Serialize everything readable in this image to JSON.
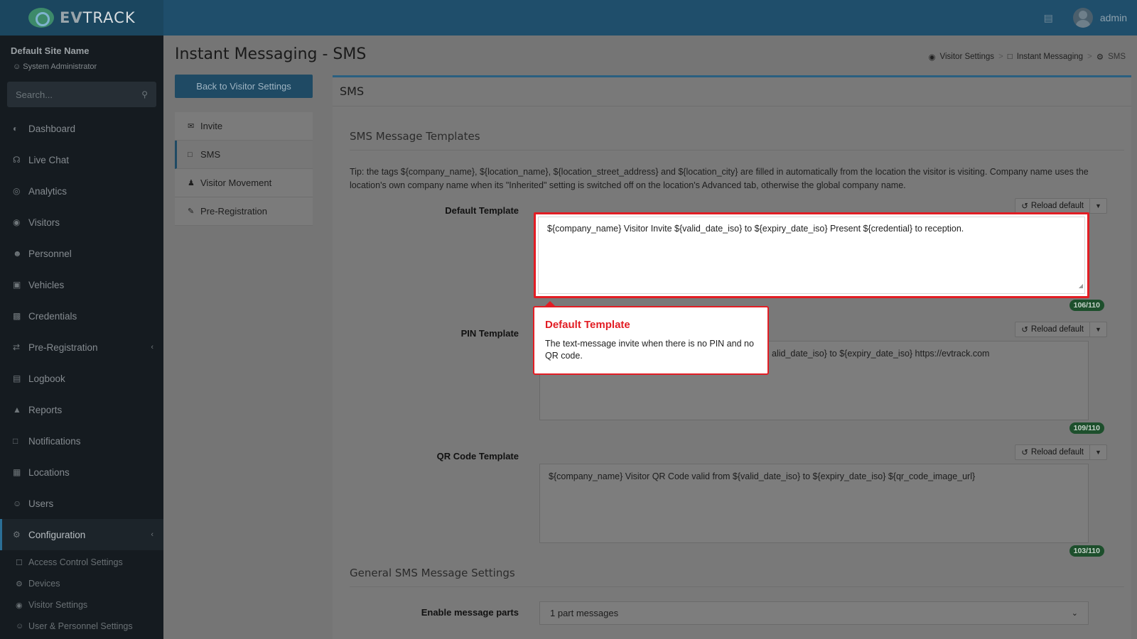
{
  "brand": {
    "logo_prefix": "EV",
    "logo_suffix": "TRACK"
  },
  "topbar": {
    "user_name": "admin"
  },
  "sidebar": {
    "site_name": "Default Site Name",
    "role": "System Administrator",
    "search_placeholder": "Search...",
    "items": [
      {
        "label": "Dashboard",
        "icon": "dashboard-icon"
      },
      {
        "label": "Live Chat",
        "icon": "headset-icon"
      },
      {
        "label": "Analytics",
        "icon": "target-icon"
      },
      {
        "label": "Visitors",
        "icon": "eye-icon"
      },
      {
        "label": "Personnel",
        "icon": "user-gear-icon"
      },
      {
        "label": "Vehicles",
        "icon": "car-icon"
      },
      {
        "label": "Credentials",
        "icon": "id-card-icon"
      },
      {
        "label": "Pre-Registration",
        "icon": "arrows-icon"
      },
      {
        "label": "Logbook",
        "icon": "book-icon"
      },
      {
        "label": "Reports",
        "icon": "chart-icon"
      },
      {
        "label": "Notifications",
        "icon": "message-icon"
      },
      {
        "label": "Locations",
        "icon": "building-icon"
      },
      {
        "label": "Users",
        "icon": "users-icon"
      },
      {
        "label": "Configuration",
        "icon": "gear-icon"
      }
    ],
    "sub_items": [
      {
        "label": "Access Control Settings",
        "icon": "lock-icon"
      },
      {
        "label": "Devices",
        "icon": "chip-icon"
      },
      {
        "label": "Visitor Settings",
        "icon": "eye-icon"
      },
      {
        "label": "User & Personnel Settings",
        "icon": "user-icon"
      }
    ]
  },
  "page": {
    "title": "Instant Messaging - SMS",
    "breadcrumb": [
      "Visitor Settings",
      "Instant Messaging",
      "SMS"
    ],
    "back_button": "Back to Visitor Settings",
    "subnav": [
      {
        "label": "Invite",
        "icon": "envelope-icon"
      },
      {
        "label": "SMS",
        "icon": "comment-icon"
      },
      {
        "label": "Visitor Movement",
        "icon": "walking-icon"
      },
      {
        "label": "Pre-Registration",
        "icon": "user-edit-icon"
      }
    ]
  },
  "card": {
    "header": "SMS",
    "section_templates": "SMS Message Templates",
    "tip": "Tip: the tags ${company_name}, ${location_name}, ${location_street_address} and ${location_city} are filled in automatically from the location the visitor is visiting. Company name uses the location's own company name when its \"Inherited\" setting is switched off on the location's Advanced tab, otherwise the global company name.",
    "reload_label": "Reload default",
    "templates": [
      {
        "label": "Default Template",
        "value": "${company_name} Visitor Invite ${valid_date_iso} to ${expiry_date_iso} Present ${credential} to reception.",
        "count": "106/110"
      },
      {
        "label": "PIN Template",
        "value": "alid_date_iso} to ${expiry_date_iso} https://evtrack.com",
        "count": "109/110"
      },
      {
        "label": "QR Code Template",
        "value": "${company_name} Visitor QR Code valid from ${valid_date_iso} to ${expiry_date_iso} ${qr_code_image_url}",
        "count": "103/110"
      }
    ],
    "section_general": "General SMS Message Settings",
    "message_parts_label": "Enable message parts",
    "message_parts_value": "1 part messages"
  },
  "popover": {
    "title": "Default Template",
    "body": "The text-message invite when there is no PIN and no QR code."
  },
  "colors": {
    "highlight": "#e21d24",
    "primary": "#1f4a64",
    "counter": "#1d4f2c"
  }
}
